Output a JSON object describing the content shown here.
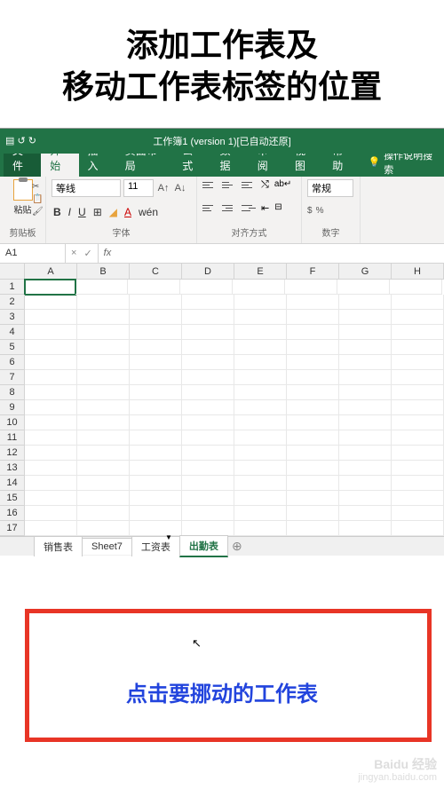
{
  "tutorial": {
    "title_line1": "添加工作表及",
    "title_line2": "移动工作表标签的位置",
    "instruction": "点击要挪动的工作表"
  },
  "titlebar": {
    "title": "工作簿1 (version 1)[已自动还原]"
  },
  "tabs": {
    "file": "文件",
    "home": "开始",
    "insert": "插入",
    "layout": "页面布局",
    "formulas": "公式",
    "data": "数据",
    "review": "审阅",
    "view": "视图",
    "help": "帮助",
    "tellme": "操作说明搜索"
  },
  "ribbon": {
    "clipboard": {
      "label": "剪贴板",
      "paste": "粘贴"
    },
    "font": {
      "label": "字体",
      "name": "等线",
      "size": "11"
    },
    "align": {
      "label": "对齐方式"
    },
    "number": {
      "label": "数字",
      "format": "常规"
    }
  },
  "namebox": "A1",
  "columns": [
    "A",
    "B",
    "C",
    "D",
    "E",
    "F",
    "G",
    "H"
  ],
  "rows": [
    "1",
    "2",
    "3",
    "4",
    "5",
    "6",
    "7",
    "8",
    "9",
    "10",
    "11",
    "12",
    "13",
    "14",
    "15",
    "16",
    "17"
  ],
  "sheets": {
    "s1": "销售表",
    "s2": "Sheet7",
    "s3": "工资表",
    "s4": "出勤表",
    "add": "⊕"
  },
  "watermark": {
    "brand": "Baidu 经验",
    "url": "jingyan.baidu.com"
  }
}
